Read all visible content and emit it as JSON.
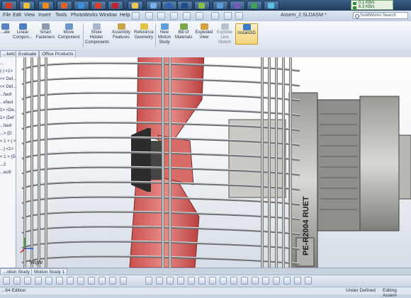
{
  "taskbar": {
    "language": "EN",
    "net_up": "0.1 KB/s",
    "net_down": "6.3 KB/s",
    "apps": [
      {
        "icon": "pdf-icon",
        "color": "#d23a2a"
      },
      {
        "icon": "explorer-icon",
        "color": "#e9c13a"
      },
      {
        "icon": "media-player-icon",
        "color": "#f08a1a"
      },
      {
        "icon": "firefox-icon",
        "color": "#e0622a"
      },
      {
        "icon": "ie-icon",
        "color": "#3b8fe0"
      },
      {
        "icon": "chrome-icon",
        "color": "#d8402e"
      },
      {
        "icon": "solidworks-icon",
        "color": "#c8202c"
      },
      {
        "icon": "folder-icon",
        "color": "#f0c850"
      },
      {
        "icon": "window-icon",
        "color": "#7ab0e6"
      },
      {
        "icon": "word-icon",
        "color": "#2f5fad"
      },
      {
        "icon": "photoshop-icon",
        "color": "#1c4a8a"
      },
      {
        "icon": "paint-icon",
        "color": "#8ac04a"
      },
      {
        "icon": "app-icon",
        "color": "#5b9ad6"
      },
      {
        "icon": "app-icon",
        "color": "#7a5ab8"
      },
      {
        "icon": "app-icon",
        "color": "#3fa05a"
      },
      {
        "icon": "app-icon",
        "color": "#5bc0e6"
      }
    ]
  },
  "menubar": {
    "items": [
      "File",
      "Edit",
      "View",
      "Insert",
      "Tools",
      "PhotoWorks",
      "Window",
      "Help"
    ],
    "document_title": "Assem_2.SLDASM *",
    "search_placeholder": "SolidWorks Search"
  },
  "ribbon": {
    "buttons": [
      {
        "label": "...ate",
        "icon": "edit-component-icon"
      },
      {
        "label": "Linear Compon...",
        "icon": "linear-pattern-icon"
      },
      {
        "label": "Smart Fasteners",
        "icon": "smart-fasteners-icon"
      },
      {
        "label": "Move Component",
        "icon": "move-component-icon"
      },
      {
        "label": "Show Hidden Components",
        "icon": "show-hidden-icon"
      },
      {
        "label": "Assembly Features",
        "icon": "assembly-features-icon"
      },
      {
        "label": "Reference Geometry",
        "icon": "reference-geometry-icon"
      },
      {
        "label": "New Motion Study",
        "icon": "motion-study-icon"
      },
      {
        "label": "Bill of Materials",
        "icon": "bom-icon"
      },
      {
        "label": "Exploded View",
        "icon": "exploded-view-icon"
      },
      {
        "label": "Explode Line Sketch",
        "icon": "explode-line-icon"
      },
      {
        "label": "Instant3D",
        "icon": "instant3d-icon"
      }
    ]
  },
  "tabs": [
    "...ketch",
    "Evaluate",
    "Office Products"
  ],
  "tree": {
    "items": [
      "...",
      "(-) <1>",
      "<< Def...",
      "<< Def...",
      "...fault",
      "...efaul",
      "1> <De...",
      "1> (Def",
      "...fault",
      "...> (D",
      "< 1 > ( <",
      "...) <1>",
      "< 1 > (D",
      "...2",
      "...ecifi"
    ]
  },
  "viewport": {
    "view_label": "*Right",
    "nameplate": "PE-R2004 RUET"
  },
  "motion_tabs": [
    "...otion Study 2",
    "Motion Study 1"
  ],
  "status": {
    "left": "...64 Edition",
    "middle": "Under Defined",
    "right": "Editing Assem"
  }
}
